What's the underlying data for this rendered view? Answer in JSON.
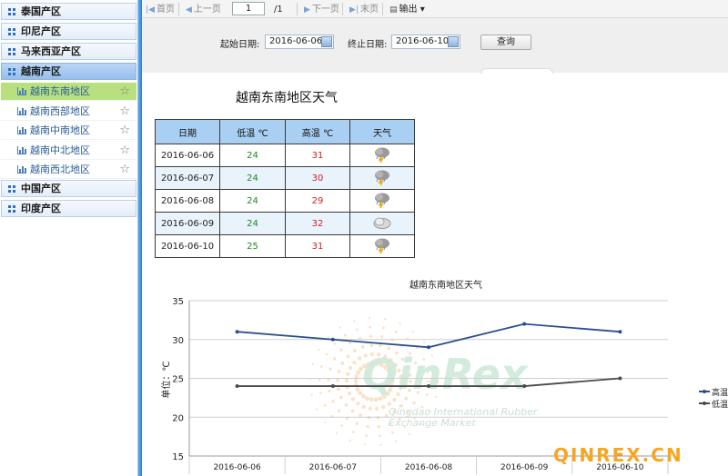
{
  "sidebar": {
    "groups_top": [
      {
        "label": "泰国产区"
      },
      {
        "label": "印尼产区"
      },
      {
        "label": "马来西亚产区"
      },
      {
        "label": "越南产区"
      }
    ],
    "sub_items": [
      {
        "label": "越南东南地区"
      },
      {
        "label": "越南西部地区"
      },
      {
        "label": "越南中南地区"
      },
      {
        "label": "越南中北地区"
      },
      {
        "label": "越南西北地区"
      }
    ],
    "groups_bottom": [
      {
        "label": "中国产区"
      },
      {
        "label": "印度产区"
      }
    ]
  },
  "toolbar": {
    "first": "首页",
    "prev": "上一页",
    "page_value": "1",
    "page_total": "/1",
    "next": "下一页",
    "last": "末页",
    "export": "输出"
  },
  "filter": {
    "start_label": "起始日期:",
    "start_value": "2016-06-06",
    "end_label": "终止日期:",
    "end_value": "2016-06-10",
    "query_label": "查询"
  },
  "report": {
    "title": "越南东南地区天气",
    "headers": [
      "日期",
      "低温 ℃",
      "高温 ℃",
      "天气"
    ],
    "rows": [
      {
        "date": "2016-06-06",
        "low": "24",
        "high": "31",
        "weather": "thunderstorm-icon"
      },
      {
        "date": "2016-06-07",
        "low": "24",
        "high": "30",
        "weather": "thunderstorm-icon"
      },
      {
        "date": "2016-06-08",
        "low": "24",
        "high": "29",
        "weather": "thunderstorm-icon"
      },
      {
        "date": "2016-06-09",
        "low": "24",
        "high": "32",
        "weather": "cloudy-icon"
      },
      {
        "date": "2016-06-10",
        "low": "25",
        "high": "31",
        "weather": "thunderstorm-icon"
      }
    ]
  },
  "chart_data": {
    "type": "line",
    "title": "越南东南地区天气",
    "ylabel": "单位：℃",
    "xlabel": "",
    "categories": [
      "2016-06-06",
      "2016-06-07",
      "2016-06-08",
      "2016-06-09",
      "2016-06-10"
    ],
    "series": [
      {
        "name": "高温",
        "values": [
          31,
          30,
          29,
          32,
          31
        ],
        "color": "#2a4f8f"
      },
      {
        "name": "低温",
        "values": [
          24,
          24,
          24,
          24,
          25
        ],
        "color": "#4a4a4a"
      }
    ],
    "ylim": [
      15,
      35
    ],
    "yticks": [
      "35",
      "30",
      "25",
      "20",
      "15"
    ],
    "grid": true,
    "legend": "right"
  },
  "watermark": {
    "brand": "QinRex",
    "line1": "Qingdao International Rubber",
    "line2": "Exchange Market",
    "site": "QINREX.CN"
  },
  "colors": {
    "accent": "#2f7fd1",
    "active_sub": "#b8e07f",
    "header_bg": "#a9d0f3"
  }
}
